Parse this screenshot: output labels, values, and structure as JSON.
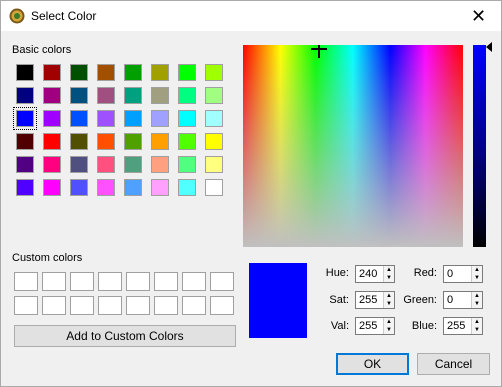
{
  "window": {
    "title": "Select Color",
    "close_glyph": "✕"
  },
  "basic_colors": {
    "label": "Basic colors",
    "colors": [
      "#000000",
      "#a00000",
      "#005000",
      "#a05000",
      "#00a000",
      "#a0a000",
      "#00ff00",
      "#a0ff00",
      "#000080",
      "#a00080",
      "#005080",
      "#a05080",
      "#00a080",
      "#a0a080",
      "#00ff80",
      "#a0ff80",
      "#0000ff",
      "#a000ff",
      "#0050ff",
      "#a050ff",
      "#00a0ff",
      "#a0a0ff",
      "#00ffff",
      "#a0ffff",
      "#500000",
      "#ff0000",
      "#505000",
      "#ff5000",
      "#50a000",
      "#ffa000",
      "#50ff00",
      "#ffff00",
      "#500080",
      "#ff0080",
      "#505080",
      "#ff5080",
      "#50a080",
      "#ffa080",
      "#50ff80",
      "#ffff80",
      "#5000ff",
      "#ff00ff",
      "#5050ff",
      "#ff50ff",
      "#50a0ff",
      "#ffa0ff",
      "#50ffff",
      "#ffffff"
    ],
    "selected_index": 16
  },
  "custom_colors": {
    "label": "Custom colors",
    "count": 16
  },
  "add_button": "Add to Custom Colors",
  "current_color": "#0000ff",
  "fields": {
    "hue": {
      "label": "Hue:",
      "value": "240"
    },
    "sat": {
      "label": "Sat:",
      "value": "255"
    },
    "val": {
      "label": "Val:",
      "value": "255"
    },
    "red": {
      "label": "Red:",
      "value": "0"
    },
    "green": {
      "label": "Green:",
      "value": "0"
    },
    "blue": {
      "label": "Blue:",
      "value": "255"
    }
  },
  "buttons": {
    "ok": "OK",
    "cancel": "Cancel"
  }
}
